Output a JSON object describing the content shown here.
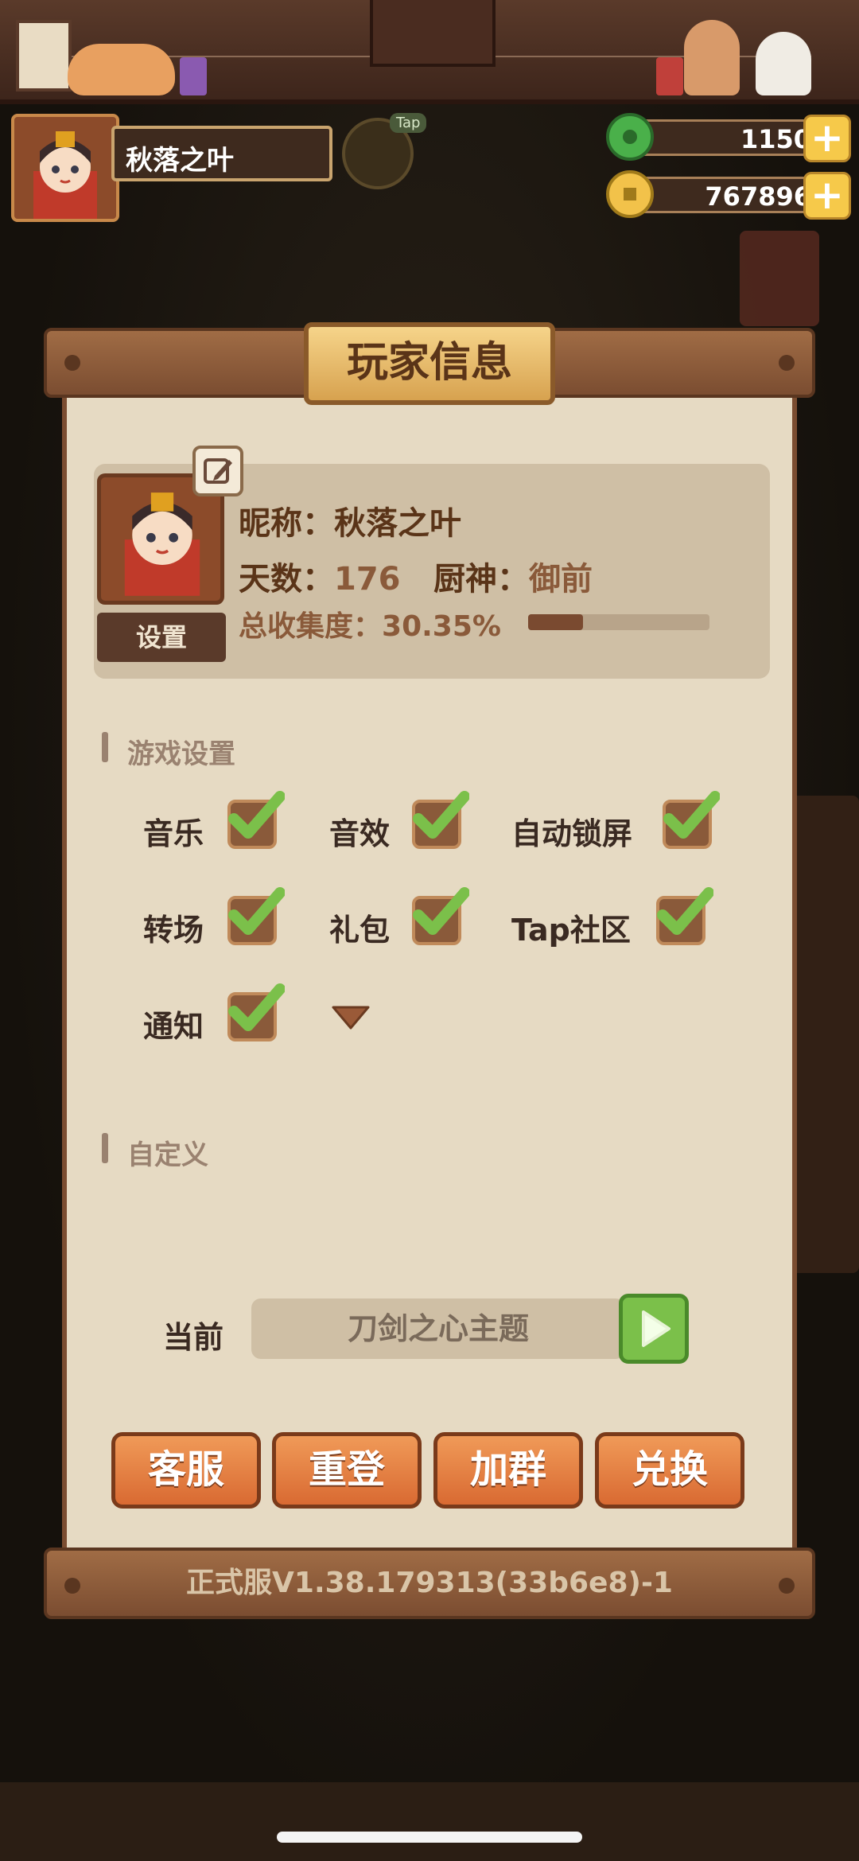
{
  "header": {
    "player_name": "秋落之叶",
    "tap_label": "Tap",
    "jade_amount": "1150",
    "coin_amount": "767896"
  },
  "panel": {
    "title": "玩家信息",
    "profile": {
      "nickname_label": "昵称：",
      "nickname": "秋落之叶",
      "days_label": "天数：",
      "days": "176",
      "chef_label": "厨神：",
      "chef": "御前",
      "collection_label": "总收集度：",
      "collection": "30.35%",
      "collection_fraction": 0.3035,
      "settings_label": "设置"
    },
    "game_settings": {
      "heading": "游戏设置",
      "options": [
        {
          "label": "音乐",
          "checked": true
        },
        {
          "label": "音效",
          "checked": true
        },
        {
          "label": "自动锁屏",
          "checked": true
        },
        {
          "label": "转场",
          "checked": true
        },
        {
          "label": "礼包",
          "checked": true
        },
        {
          "label": "Tap社区",
          "checked": true
        },
        {
          "label": "通知",
          "checked": true
        }
      ]
    },
    "custom": {
      "heading": "自定义",
      "current_label": "当前",
      "current_theme": "刀剑之心主题"
    },
    "actions": [
      "客服",
      "重登",
      "加群",
      "兑换"
    ],
    "version": "正式服V1.38.179313(33b6e8)-1"
  },
  "colors": {
    "panel_bg": "#e6dac3",
    "wood": "#7b4d31",
    "button_orange": "#e07a3a",
    "check_green": "#7bc04a"
  }
}
